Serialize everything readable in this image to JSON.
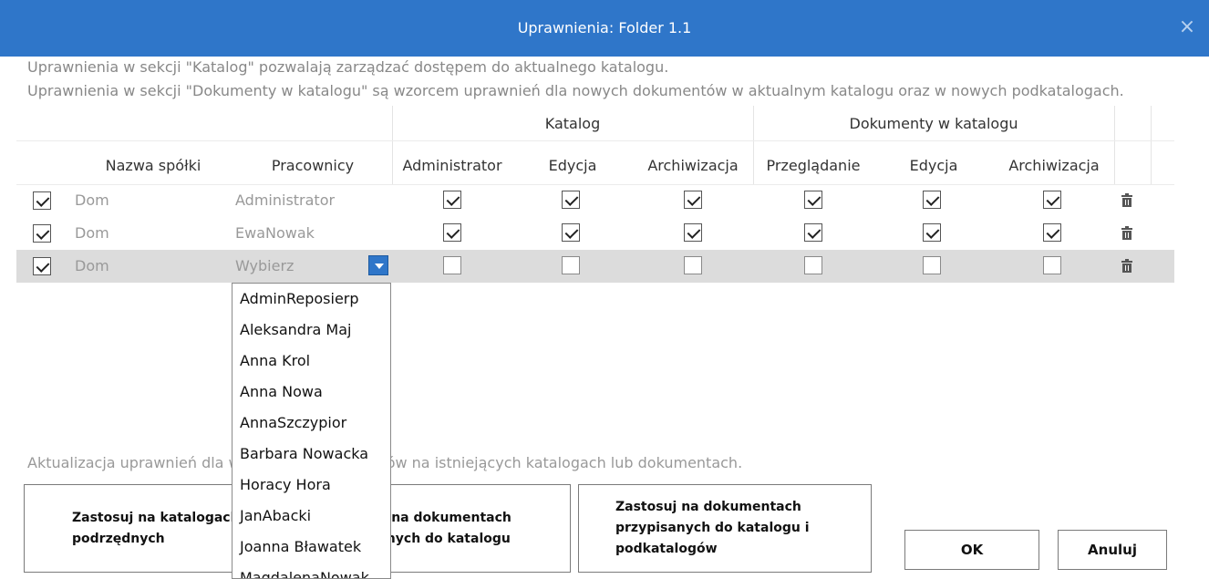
{
  "window": {
    "title": "Uprawnienia: Folder 1.1",
    "close_glyph": "×"
  },
  "info": {
    "line1": "Uprawnienia w sekcji \"Katalog\" pozwalają zarządzać dostępem do aktualnego katalogu.",
    "line2": "Uprawnienia w sekcji \"Dokumenty w katalogu\" są wzorcem uprawnień dla nowych dokumentów w aktualnym katalogu oraz w nowych podkatalogach."
  },
  "table": {
    "group_catalog": "Katalog",
    "group_documents": "Dokumenty w katalogu",
    "columns": {
      "company": "Nazwa spółki",
      "employees": "Pracownicy",
      "cat_admin": "Administrator",
      "cat_edit": "Edycja",
      "cat_archive": "Archiwizacja",
      "doc_view": "Przeglądanie",
      "doc_edit": "Edycja",
      "doc_archive": "Archiwizacja"
    },
    "rows": [
      {
        "checked": true,
        "company": "Dom",
        "employee": "Administrator",
        "perms": [
          true,
          true,
          true,
          true,
          true,
          true
        ],
        "selected": false
      },
      {
        "checked": true,
        "company": "Dom",
        "employee": "EwaNowak",
        "perms": [
          true,
          true,
          true,
          true,
          true,
          true
        ],
        "selected": false
      },
      {
        "checked": true,
        "company": "Dom",
        "employee": "Wybierz",
        "perms": [
          false,
          false,
          false,
          false,
          false,
          false
        ],
        "selected": true
      }
    ]
  },
  "dropdown": {
    "options": [
      "AdminReposierp",
      "Aleksandra Maj",
      "Anna Krol",
      "Anna Nowa",
      "AnnaSzczypior",
      "Barbara Nowacka",
      "Horacy Hora",
      "JanAbacki",
      "Joanna Bławatek",
      "MagdalenaNowak"
    ]
  },
  "update": {
    "text": "Aktualizacja uprawnień dla wszystkich pracowników na istniejących katalogach lub dokumentach.",
    "btn1": "Zastosuj na katalogach podrzędnych",
    "btn2": "Zastosuj na dokumentach przypisanych do katalogu",
    "btn3": "Zastosuj na dokumentach przypisanych do katalogu i podkatalogów"
  },
  "actions": {
    "ok": "OK",
    "cancel": "Anuluj"
  },
  "colors": {
    "accent": "#2f76c9",
    "selected_row": "#dcdcdc"
  },
  "icons": {
    "delete": "trash-icon",
    "dropdown": "chevron-down-icon",
    "close": "close-icon"
  }
}
